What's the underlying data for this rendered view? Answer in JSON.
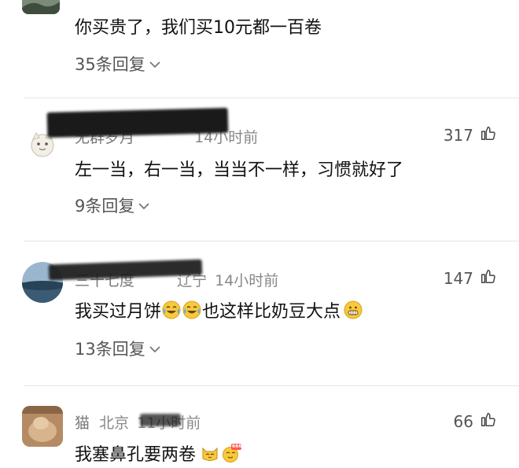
{
  "comments": [
    {
      "text": "你买贵了，我们买10元都一百卷",
      "replies": "35条回复"
    },
    {
      "username": "无群岁月",
      "time": "14小时前",
      "likes": "317",
      "text": "左一当，右一当，当当不一样，习惯就好了",
      "replies": "9条回复"
    },
    {
      "username": "三十七度",
      "region": "辽宁",
      "time": "14小时前",
      "likes": "147",
      "text_before": "我买过月饼",
      "text_after": "也这样比奶豆大点",
      "replies": "13条回复"
    },
    {
      "username": "猫",
      "region": "北京",
      "time": "11小时前",
      "likes": "66",
      "text": "我塞鼻孔要两卷",
      "emoji_label": "666"
    }
  ],
  "icons": {
    "like": "thumbs-up-icon",
    "chevron": "chevron-down-icon",
    "emoji_cry_laugh": "tears-of-joy-emoji",
    "emoji_grin": "grinning-emoji",
    "emoji_cat": "cat-emoji",
    "emoji_666": "666-emoji"
  },
  "colors": {
    "meta": "#888888",
    "divider": "#e6e6e6",
    "emoji_yellow": "#f8c93b"
  }
}
